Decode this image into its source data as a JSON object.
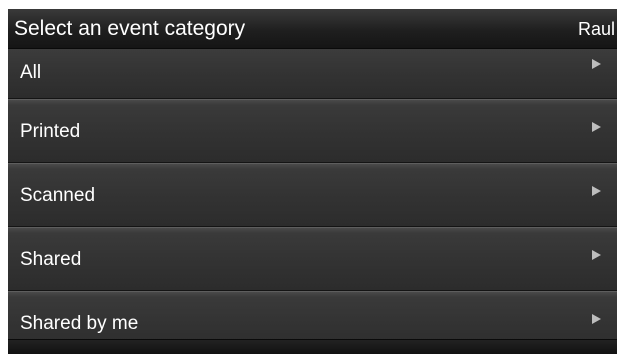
{
  "header": {
    "title": "Select an event category",
    "user": "Raul"
  },
  "categories": [
    {
      "label": "All"
    },
    {
      "label": "Printed"
    },
    {
      "label": "Scanned"
    },
    {
      "label": "Shared"
    },
    {
      "label": "Shared by me"
    }
  ],
  "colors": {
    "background": "#2b2b2b",
    "text": "#ffffff",
    "arrow": "#bdbdbd"
  },
  "icons": {
    "row_arrow": "play-right-triangle"
  }
}
